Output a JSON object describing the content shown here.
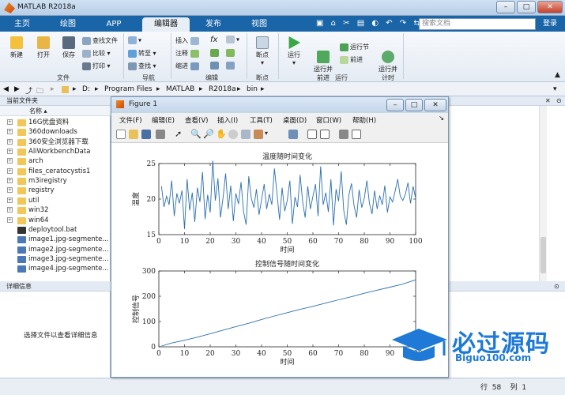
{
  "window": {
    "title": "MATLAB R2018a"
  },
  "tabs": [
    {
      "label": "主页",
      "active": false
    },
    {
      "label": "绘图",
      "active": false
    },
    {
      "label": "APP",
      "active": false
    },
    {
      "label": "编辑器",
      "active": true
    },
    {
      "label": "发布",
      "active": false
    },
    {
      "label": "视图",
      "active": false
    }
  ],
  "search": {
    "placeholder": "搜索文档"
  },
  "login_label": "登录",
  "ribbon": {
    "file": {
      "new": "新建",
      "open": "打开",
      "save": "保存",
      "find_files": "查找文件",
      "compare": "比较",
      "print": "打印",
      "group": "文件"
    },
    "nav": {
      "goto": "转至",
      "find": "查找",
      "group": "导航"
    },
    "edit": {
      "insert": "插入",
      "comment": "注释",
      "indent": "缩进",
      "fx": "fx",
      "group": "编辑"
    },
    "breakpoints": {
      "label": "断点",
      "group": "断点"
    },
    "run": {
      "run": "运行",
      "run_advance": "运行并\n前进",
      "run_section": "运行节",
      "advance": "前进",
      "run_time": "运行并\n计时",
      "group": "运行"
    }
  },
  "address": {
    "parts": [
      "D:",
      "Program Files",
      "MATLAB",
      "R2018a",
      "bin"
    ]
  },
  "left_panel": {
    "title": "当前文件夹",
    "column": "名称",
    "items": [
      {
        "name": "16G优盘资料",
        "type": "folder"
      },
      {
        "name": "360downloads",
        "type": "folder"
      },
      {
        "name": "360安全浏览器下载",
        "type": "folder"
      },
      {
        "name": "AliWorkbenchData",
        "type": "folder"
      },
      {
        "name": "arch",
        "type": "folder"
      },
      {
        "name": "files_ceratocystis1",
        "type": "folder"
      },
      {
        "name": "m3iregistry",
        "type": "folder"
      },
      {
        "name": "registry",
        "type": "folder"
      },
      {
        "name": "util",
        "type": "folder"
      },
      {
        "name": "win32",
        "type": "folder"
      },
      {
        "name": "win64",
        "type": "folder"
      },
      {
        "name": "deploytool.bat",
        "type": "bat"
      },
      {
        "name": "image1.jpg-segmente...",
        "type": "file"
      },
      {
        "name": "image2.jpg-segmente...",
        "type": "file"
      },
      {
        "name": "image3.jpg-segmente...",
        "type": "file"
      },
      {
        "name": "image4.jpg-segmente...",
        "type": "file"
      }
    ]
  },
  "detail_panel": {
    "title": "详细信息",
    "message": "选择文件以查看详细信息"
  },
  "status": {
    "row_label": "行",
    "row": "58",
    "col_label": "列",
    "col": "1"
  },
  "figure": {
    "title": "Figure 1",
    "menu": [
      "文件(F)",
      "编辑(E)",
      "查看(V)",
      "插入(I)",
      "工具(T)",
      "桌面(D)",
      "窗口(W)",
      "帮助(H)"
    ]
  },
  "watermark": {
    "main": "必过源码",
    "sub": "Biguo100.com"
  },
  "colors": {
    "tabstrip": "#1a64a8",
    "line": "#2b6fb0",
    "watermark": "#1e7ad6"
  },
  "chart_data": [
    {
      "type": "line",
      "title": "温度随时间变化",
      "xlabel": "时间",
      "ylabel": "温度",
      "xlim": [
        0,
        100
      ],
      "ylim": [
        15,
        25
      ],
      "xticks": [
        0,
        10,
        20,
        30,
        40,
        50,
        60,
        70,
        80,
        90,
        100
      ],
      "yticks": [
        15,
        20,
        25
      ],
      "x": [
        1,
        2,
        3,
        4,
        5,
        6,
        7,
        8,
        9,
        10,
        11,
        12,
        13,
        14,
        15,
        16,
        17,
        18,
        19,
        20,
        21,
        22,
        23,
        24,
        25,
        26,
        27,
        28,
        29,
        30,
        31,
        32,
        33,
        34,
        35,
        36,
        37,
        38,
        39,
        40,
        41,
        42,
        43,
        44,
        45,
        46,
        47,
        48,
        49,
        50,
        51,
        52,
        53,
        54,
        55,
        56,
        57,
        58,
        59,
        60,
        61,
        62,
        63,
        64,
        65,
        66,
        67,
        68,
        69,
        70,
        71,
        72,
        73,
        74,
        75,
        76,
        77,
        78,
        79,
        80,
        81,
        82,
        83,
        84,
        85,
        86,
        87,
        88,
        89,
        90,
        91,
        92,
        93,
        94,
        95,
        96,
        97,
        98,
        99,
        100
      ],
      "values": [
        21.8,
        18.9,
        20.4,
        19.2,
        22.6,
        17.6,
        20.8,
        19.4,
        21.2,
        15.8,
        22.8,
        18.4,
        20.9,
        16.8,
        21.6,
        19.6,
        23.8,
        17.2,
        20.6,
        18.1,
        25.4,
        19.8,
        22.9,
        17.4,
        20.2,
        23.6,
        18.6,
        21.9,
        16.9,
        20.8,
        19.3,
        22.4,
        18.2,
        16.4,
        23.2,
        20.1,
        18.8,
        21.4,
        17.8,
        19.9,
        22.1,
        18.6,
        20.7,
        19.2,
        24.3,
        20.8,
        17.1,
        21.6,
        18.3,
        19.8,
        22.6,
        16.5,
        20.3,
        18.9,
        23.4,
        19.6,
        17.4,
        21.8,
        18.6,
        20.4,
        22.1,
        17.6,
        24.6,
        19.2,
        20.9,
        18.2,
        22.8,
        16.3,
        21.4,
        19.7,
        23.9,
        18.4,
        16.4,
        20.6,
        22.2,
        19.1,
        17.4,
        21.3,
        18.8,
        20.1,
        22.6,
        19.4,
        17.9,
        21.2,
        18.6,
        20.5,
        19.2,
        21.9,
        18.1,
        20.3,
        19.6,
        21.1,
        22.8,
        20.4,
        19.8,
        20.7,
        22.3,
        19.4,
        21.8,
        20.1
      ]
    },
    {
      "type": "line",
      "title": "控制信号随时间变化",
      "xlabel": "时间",
      "ylabel": "控制信号",
      "xlim": [
        0,
        100
      ],
      "ylim": [
        0,
        300
      ],
      "xticks": [
        0,
        10,
        20,
        30,
        40,
        50,
        60,
        70,
        80,
        90,
        100
      ],
      "yticks": [
        0,
        100,
        200,
        300
      ],
      "x": [
        1,
        5,
        10,
        15,
        20,
        25,
        30,
        35,
        40,
        45,
        50,
        55,
        60,
        65,
        70,
        75,
        80,
        85,
        90,
        95,
        100
      ],
      "values": [
        3,
        15,
        26,
        38,
        52,
        66,
        80,
        93,
        108,
        122,
        135,
        148,
        160,
        173,
        186,
        198,
        212,
        224,
        236,
        248,
        265
      ]
    }
  ]
}
